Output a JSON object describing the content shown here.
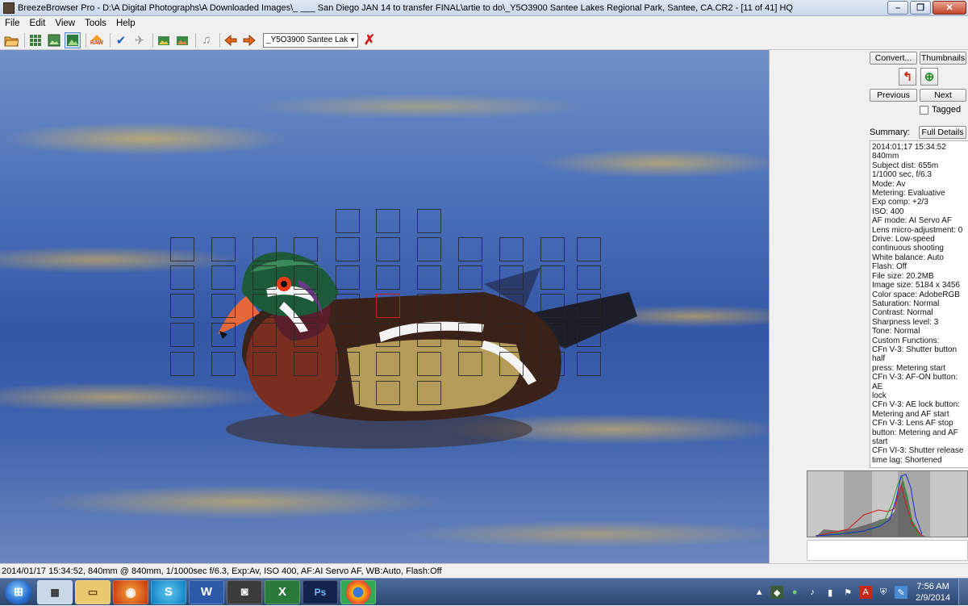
{
  "window": {
    "title": "BreezeBrowser Pro - D:\\A Digital Photographs\\A Downloaded Images\\_ ___  San Diego JAN 14 to transfer FINAL\\artie to do\\_Y5O3900  Santee Lakes Regional Park, Santee, CA.CR2 - [11 of 41] HQ",
    "buttons": {
      "minimize": "–",
      "maximize": "❐",
      "close": "✕"
    }
  },
  "menu": [
    "File",
    "Edit",
    "View",
    "Tools",
    "Help"
  ],
  "toolbar": {
    "icons": [
      "open-folder-icon",
      "thumbnails-grid-icon",
      "thumbnails-preview-icon",
      "image-view-icon",
      "raw-icon",
      "tag-check-icon",
      "untag-icon",
      "image-left-icon",
      "image-right-icon",
      "music-icon",
      "arrow-left-icon",
      "arrow-right-icon",
      "delete-icon"
    ],
    "raw_label": "RAW",
    "file_select": "_Y5O3900  Santee Lak"
  },
  "panel": {
    "convert_label": "Convert...",
    "thumbnails_label": "Thumbnails",
    "previous_label": "Previous",
    "next_label": "Next",
    "tagged_label": "Tagged",
    "summary_label": "Summary:",
    "full_details_label": "Full Details",
    "details": [
      "2014:01:17 15:34:52",
      "840mm",
      "Subject dist: 655m",
      "1/1000 sec, f/6.3",
      "Mode: Av",
      "Metering: Evaluative",
      "Exp comp: +2/3",
      "ISO: 400",
      "AF mode: AI Servo AF",
      "Lens micro-adjustment: 0",
      "Drive: Low-speed",
      "continuous shooting",
      "White balance: Auto",
      "Flash: Off",
      "File size: 20.2MB",
      "Image size: 5184 x 3456",
      "Color space: AdobeRGB",
      "Saturation: Normal",
      "Contrast: Normal",
      "Sharpness level: 3",
      "Tone: Normal",
      "Custom Functions:",
      "CFn V-3: Shutter button half",
      "press: Metering start",
      "CFn V-3: AF-ON button: AE",
      "lock",
      "CFn V-3: AE lock button:",
      "Metering and AF start",
      "CFn V-3: Lens AF stop",
      "button: Metering and AF",
      "start",
      "CFn VI-3: Shutter release",
      "time lag: Shortened"
    ]
  },
  "status": "2014/01/17 15:34:52, 840mm @ 840mm, 1/1000sec f/6.3, Exp:Av, ISO 400, AF:AI Servo AF, WB:Auto, Flash:Off",
  "taskbar": {
    "apps": [
      "calculator-icon",
      "explorer-icon",
      "firefox-icon",
      "skype-icon",
      "word-icon",
      "camera-icon",
      "excel-icon",
      "photoshop-icon",
      "chrome-icon"
    ],
    "time": "7:56 AM",
    "date": "2/9/2014"
  },
  "colors": {
    "af_active": "#d21818",
    "accent": "#2b4673"
  }
}
